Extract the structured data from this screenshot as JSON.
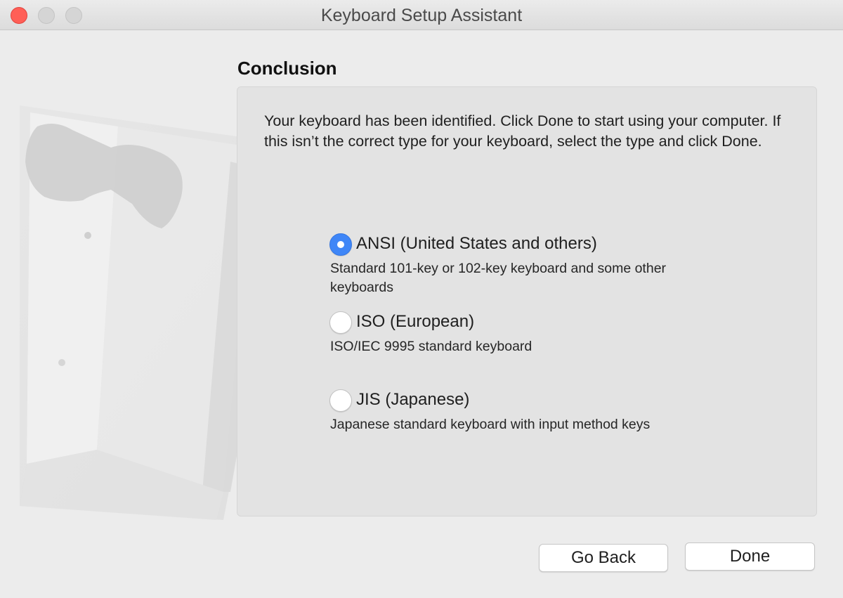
{
  "window": {
    "title": "Keyboard Setup Assistant"
  },
  "page": {
    "heading": "Conclusion",
    "intro": "Your keyboard has been identified. Click Done to start using your computer. If this isn’t the correct type for your keyboard, select the type and click Done."
  },
  "options": [
    {
      "label": "ANSI (United States and others)",
      "description": "Standard 101-key or 102-key keyboard and some other keyboards",
      "selected": true
    },
    {
      "label": "ISO (European)",
      "description": "ISO/IEC 9995 standard keyboard",
      "selected": false
    },
    {
      "label": "JIS (Japanese)",
      "description": "Japanese standard keyboard with input method keys",
      "selected": false
    }
  ],
  "buttons": {
    "back_label": "Go Back",
    "done_label": "Done"
  },
  "colors": {
    "accent": "#3f86f7",
    "close": "#ff5f57",
    "background": "#ececec"
  },
  "icons": {
    "illustration": "tuxedo-illustration-icon"
  }
}
